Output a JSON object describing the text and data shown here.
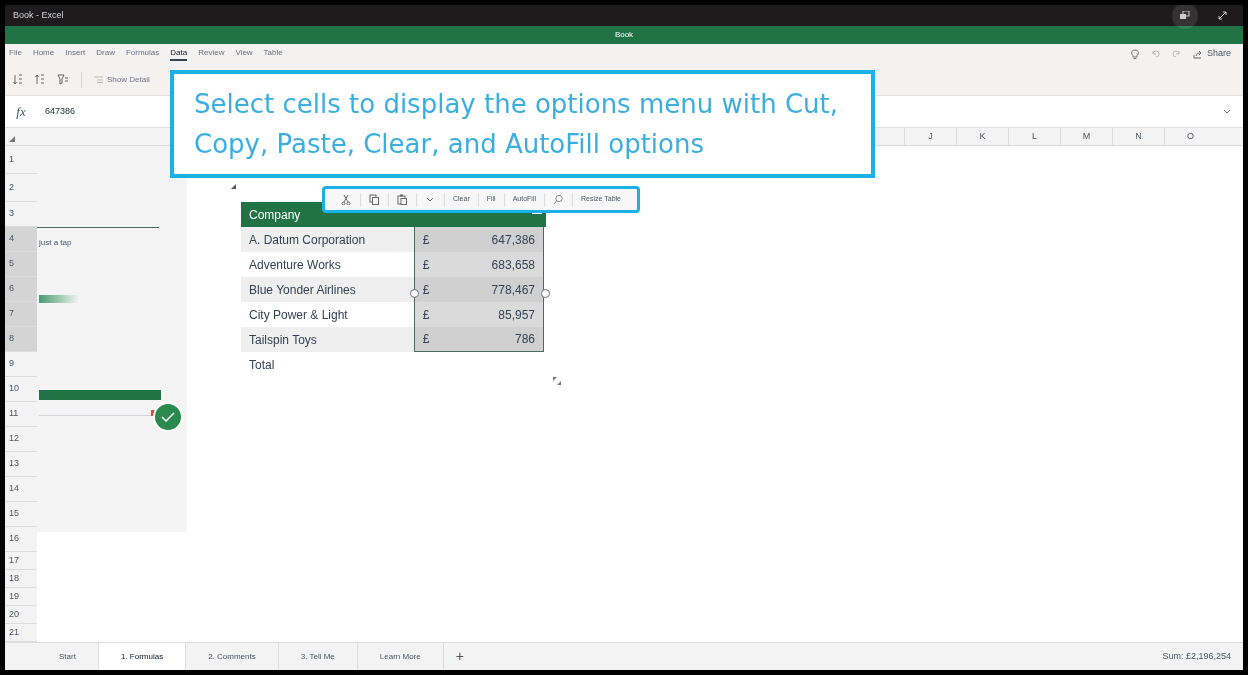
{
  "window": {
    "title": "Book - Excel"
  },
  "document_title": "Book",
  "ribbon_tabs": [
    {
      "label": "File",
      "selected": false
    },
    {
      "label": "Home",
      "selected": false
    },
    {
      "label": "Insert",
      "selected": false
    },
    {
      "label": "Draw",
      "selected": false
    },
    {
      "label": "Formulas",
      "selected": false
    },
    {
      "label": "Data",
      "selected": true
    },
    {
      "label": "Review",
      "selected": false
    },
    {
      "label": "View",
      "selected": false
    },
    {
      "label": "Table",
      "selected": false
    }
  ],
  "share": {
    "label": "Share"
  },
  "toolbar": {
    "show_detail": {
      "label": "Show Detail",
      "disabled": true
    }
  },
  "formula_bar": {
    "fx": "fx",
    "value": "647386"
  },
  "column_headers": [
    "J",
    "K",
    "L",
    "M",
    "N",
    "O"
  ],
  "row_headers": [
    {
      "label": "1",
      "selected": false
    },
    {
      "label": "2",
      "selected": false
    },
    {
      "label": "3",
      "selected": false
    },
    {
      "label": "4",
      "selected": true
    },
    {
      "label": "5",
      "selected": true
    },
    {
      "label": "6",
      "selected": true
    },
    {
      "label": "7",
      "selected": true
    },
    {
      "label": "8",
      "selected": true
    },
    {
      "label": "9",
      "selected": false
    },
    {
      "label": "10",
      "selected": false
    },
    {
      "label": "11",
      "selected": false
    },
    {
      "label": "12",
      "selected": false
    },
    {
      "label": "13",
      "selected": false
    },
    {
      "label": "14",
      "selected": false
    },
    {
      "label": "15",
      "selected": false
    },
    {
      "label": "16",
      "selected": false
    },
    {
      "label": "17",
      "selected": false
    },
    {
      "label": "18",
      "selected": false
    },
    {
      "label": "19",
      "selected": false
    },
    {
      "label": "20",
      "selected": false
    },
    {
      "label": "21",
      "selected": false
    }
  ],
  "side_panel": {
    "text": "just a tap"
  },
  "table": {
    "header": "Company",
    "rows": [
      {
        "company": "A. Datum Corporation",
        "currency": "£",
        "sales": "647,386",
        "selected": true
      },
      {
        "company": "Adventure Works",
        "currency": "£",
        "sales": "683,658",
        "selected": true
      },
      {
        "company": "Blue Yonder Airlines",
        "currency": "£",
        "sales": "778,467",
        "selected": true
      },
      {
        "company": "City Power & Light",
        "currency": "£",
        "sales": "85,957",
        "selected": true
      },
      {
        "company": "Tailspin Toys",
        "currency": "£",
        "sales": "786",
        "selected": true
      }
    ],
    "total_label": "Total"
  },
  "context_menu": {
    "items": [
      {
        "kind": "cut"
      },
      {
        "kind": "copy"
      },
      {
        "kind": "paste"
      },
      {
        "kind": "more"
      },
      {
        "kind": "text",
        "label": "Clear"
      },
      {
        "kind": "text",
        "label": "Fill"
      },
      {
        "kind": "text",
        "label": "AutoFill"
      },
      {
        "kind": "search"
      },
      {
        "kind": "text",
        "label": "Resize Table"
      }
    ]
  },
  "callout": {
    "text": "Select cells to display the options menu with Cut, Copy, Paste, Clear, and AutoFill options"
  },
  "sheet_tabs": [
    {
      "label": "Start",
      "selected": false
    },
    {
      "label": "1. Formulas",
      "selected": true
    },
    {
      "label": "2. Comments",
      "selected": false
    },
    {
      "label": "3. Tell Me",
      "selected": false
    },
    {
      "label": "Learn More",
      "selected": false
    }
  ],
  "add_sheet": "+",
  "status": {
    "sum": "Sum: £2,196,254"
  }
}
